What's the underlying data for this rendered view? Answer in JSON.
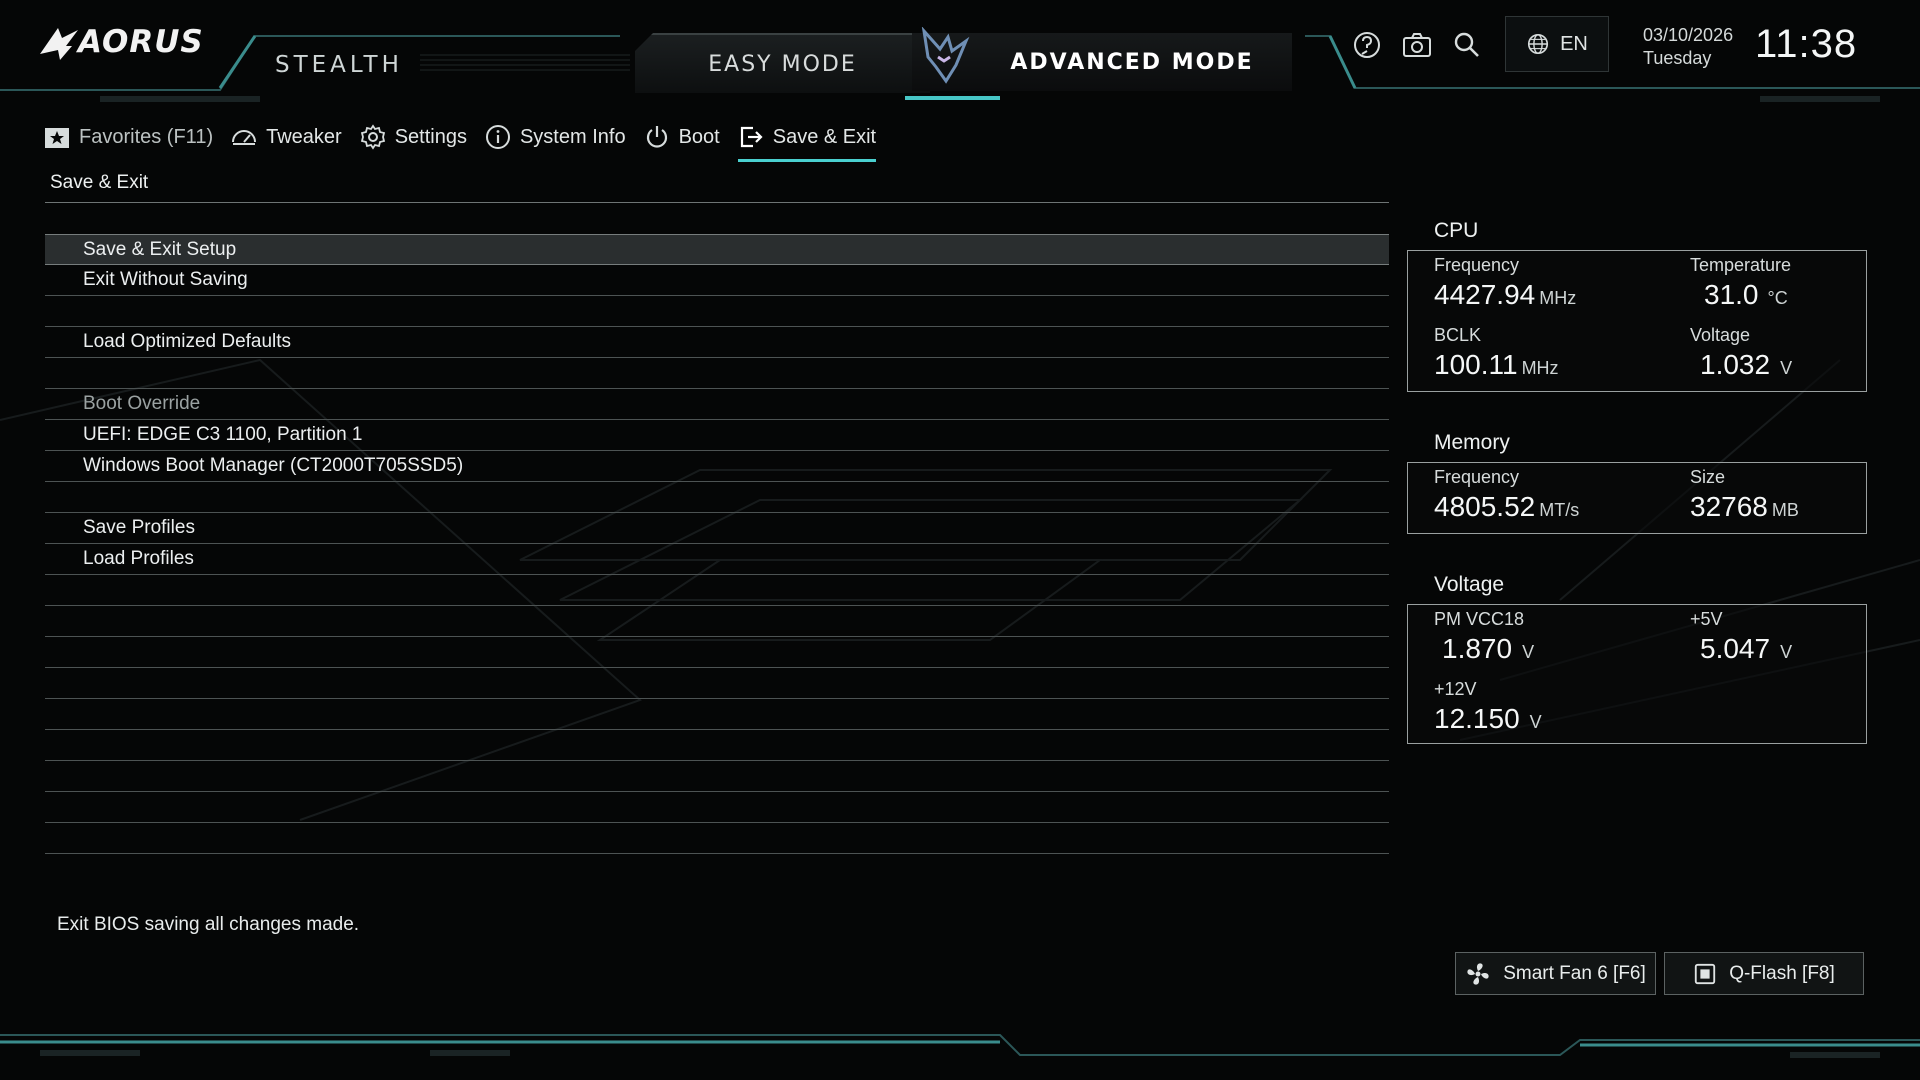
{
  "header": {
    "logo_text": "AORUS",
    "sub_brand": "STEALTH",
    "easy_mode": "EASY MODE",
    "advanced_mode": "ADVANCED MODE",
    "language": "EN",
    "date": "03/10/2026",
    "weekday": "Tuesday",
    "time": "11:38"
  },
  "nav": {
    "favorites": "Favorites (F11)",
    "tweaker": "Tweaker",
    "settings": "Settings",
    "system_info": "System Info",
    "boot": "Boot",
    "save_exit": "Save & Exit"
  },
  "content": {
    "section_title": "Save & Exit",
    "rows": {
      "r0": "Save & Exit Setup",
      "r1": "Exit Without Saving",
      "r3": "Load Optimized Defaults",
      "r5": "Boot Override",
      "r6": "UEFI: EDGE C3 1100, Partition 1",
      "r7": "Windows Boot Manager (CT2000T705SSD5)",
      "r9": "Save Profiles",
      "r10": "Load Profiles"
    },
    "help_text": "Exit BIOS saving all changes made."
  },
  "info": {
    "cpu": {
      "title": "CPU",
      "frequency_label": "Frequency",
      "frequency_value": "4427.94",
      "frequency_unit": "MHz",
      "temperature_label": "Temperature",
      "temperature_value": "31.0",
      "temperature_unit": "°C",
      "bclk_label": "BCLK",
      "bclk_value": "100.11",
      "bclk_unit": "MHz",
      "voltage_label": "Voltage",
      "voltage_value": "1.032",
      "voltage_unit": "V"
    },
    "memory": {
      "title": "Memory",
      "frequency_label": "Frequency",
      "frequency_value": "4805.52",
      "frequency_unit": "MT/s",
      "size_label": "Size",
      "size_value": "32768",
      "size_unit": "MB"
    },
    "voltage": {
      "title": "Voltage",
      "pmvcc18_label": "PM VCC18",
      "pmvcc18_value": "1.870",
      "pmvcc18_unit": "V",
      "v5_label": "+5V",
      "v5_value": "5.047",
      "v5_unit": "V",
      "v12_label": "+12V",
      "v12_value": "12.150",
      "v12_unit": "V"
    }
  },
  "buttons": {
    "smart_fan": "Smart Fan 6 [F6]",
    "qflash": "Q-Flash [F8]"
  },
  "colors": {
    "accent": "#47c6c6",
    "background": "#050606",
    "selected_row": "#2a2e2f"
  }
}
